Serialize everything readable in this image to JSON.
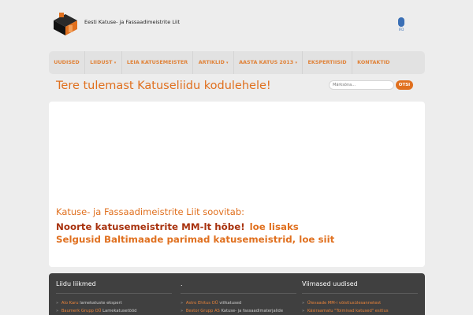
{
  "header": {
    "site_title": "Eesti Katuse- ja Fassaadimeistrite Liit",
    "partner_label": "IFD"
  },
  "nav": {
    "items": [
      {
        "label": "UUDISED",
        "has_dropdown": false
      },
      {
        "label": "LIIDUST",
        "has_dropdown": true
      },
      {
        "label": "LEIA KATUSEMEISTER",
        "has_dropdown": false
      },
      {
        "label": "ARTIKLID",
        "has_dropdown": true
      },
      {
        "label": "AASTA KATUS 2013",
        "has_dropdown": true
      },
      {
        "label": "EKSPERTIISID",
        "has_dropdown": false
      },
      {
        "label": "KONTAKTID",
        "has_dropdown": false
      }
    ]
  },
  "main": {
    "welcome_title": "Tere tulemast Katuseliidu kodulehele!",
    "recommend": "Katuse- ja Fassaadimeistrite Liit soovitab:",
    "news_line1": "Noorte katusemeistrite MM-lt hõbe!",
    "news_line1_link": "loe lisaks",
    "news_line2": "Selgusid Baltimaade parimad katusemeistrid, loe siit"
  },
  "search": {
    "placeholder": "Märksõna...",
    "button_label": "OTSI"
  },
  "footer": {
    "members": {
      "title": "Liidu liikmed",
      "items": [
        {
          "link": "Alo Karu",
          "text": "lamekatuste ekspert"
        },
        {
          "link": "Baumerk Grupp OÜ",
          "text": "Lamekatusetööd"
        }
      ]
    },
    "middle": {
      "title": ".",
      "items": [
        {
          "link": "Astro Ehitus OÜ",
          "text": "viilkatused"
        },
        {
          "link": "Bestor Grupp AS",
          "text": "Katuse- ja fassaadimaterjalide"
        }
      ]
    },
    "news": {
      "title": "Viimased uudised",
      "items": [
        {
          "link": "Ülevaade MM-i võistlusülesannetest",
          "text": ""
        },
        {
          "link": "Käsiraamatu \"Toimivad katused\" esitlus",
          "text": ""
        }
      ]
    }
  },
  "colors": {
    "accent": "#e0701f",
    "dark_accent": "#a8320e",
    "footer_bg": "#404040"
  }
}
